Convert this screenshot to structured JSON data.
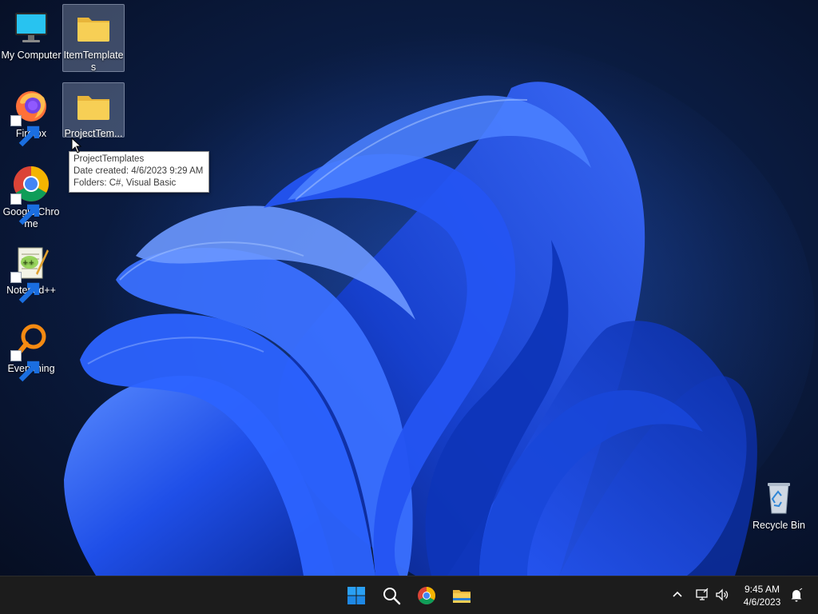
{
  "desktop": {
    "icons": [
      {
        "label": "My Computer",
        "icon": "computer-icon"
      },
      {
        "label": "ItemTemplates",
        "icon": "folder-icon"
      },
      {
        "label": "Firefox",
        "icon": "firefox-icon"
      },
      {
        "label": "ProjectTem...",
        "icon": "folder-icon"
      },
      {
        "label": "Google Chrome",
        "icon": "chrome-icon"
      },
      {
        "label": "Notepad++",
        "icon": "notepad-plus-plus-icon"
      },
      {
        "label": "Everything",
        "icon": "everything-search-icon"
      },
      {
        "label": "Recycle Bin",
        "icon": "recycle-bin-icon"
      }
    ]
  },
  "tooltip": {
    "title": "ProjectTemplates",
    "date_created": "Date created: 4/6/2023 9:29 AM",
    "folders": "Folders: C#, Visual Basic"
  },
  "taskbar": {
    "buttons": [
      "windows-start-icon",
      "search-icon",
      "chrome-icon",
      "file-explorer-icon"
    ],
    "tray": [
      "chevron-up-icon",
      "network-icon",
      "volume-icon",
      "notification-icon"
    ],
    "clock": {
      "time": "9:45 AM",
      "date": "4/6/2023"
    }
  },
  "colors": {
    "taskbar_bg": "#1c1c1c",
    "wallpaper_blue": "#1f5cff",
    "folder_yellow": "#f7cf55"
  }
}
